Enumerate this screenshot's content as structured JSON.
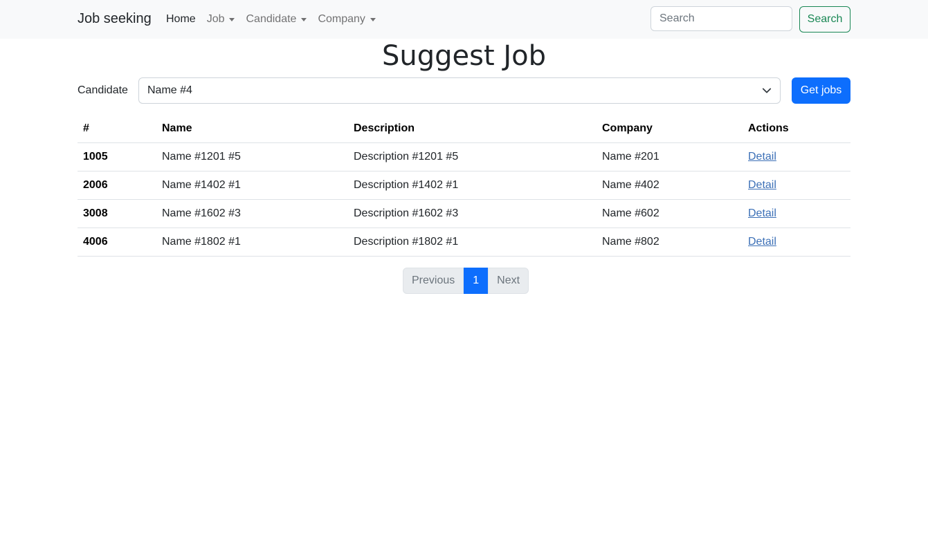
{
  "navbar": {
    "brand": "Job seeking",
    "links": [
      {
        "label": "Home",
        "dropdown": false
      },
      {
        "label": "Job",
        "dropdown": true
      },
      {
        "label": "Candidate",
        "dropdown": true
      },
      {
        "label": "Company",
        "dropdown": true
      }
    ],
    "search_placeholder": "Search",
    "search_button": "Search"
  },
  "page": {
    "title": "Suggest Job",
    "candidate_label": "Candidate",
    "candidate_selected": "Name #4",
    "get_jobs_button": "Get jobs"
  },
  "table": {
    "headers": [
      "#",
      "Name",
      "Description",
      "Company",
      "Actions"
    ],
    "rows": [
      {
        "id": "1005",
        "name": "Name #1201 #5",
        "description": "Description #1201 #5",
        "company": "Name #201",
        "action": "Detail"
      },
      {
        "id": "2006",
        "name": "Name #1402 #1",
        "description": "Description #1402 #1",
        "company": "Name #402",
        "action": "Detail"
      },
      {
        "id": "3008",
        "name": "Name #1602 #3",
        "description": "Description #1602 #3",
        "company": "Name #602",
        "action": "Detail"
      },
      {
        "id": "4006",
        "name": "Name #1802 #1",
        "description": "Description #1802 #1",
        "company": "Name #802",
        "action": "Detail"
      }
    ]
  },
  "pagination": {
    "previous": "Previous",
    "current": "1",
    "next": "Next"
  },
  "colors": {
    "primary": "#0d6efd",
    "success": "#198754",
    "navbar_bg": "#f8f9fa",
    "link": "#3b6fb6"
  }
}
